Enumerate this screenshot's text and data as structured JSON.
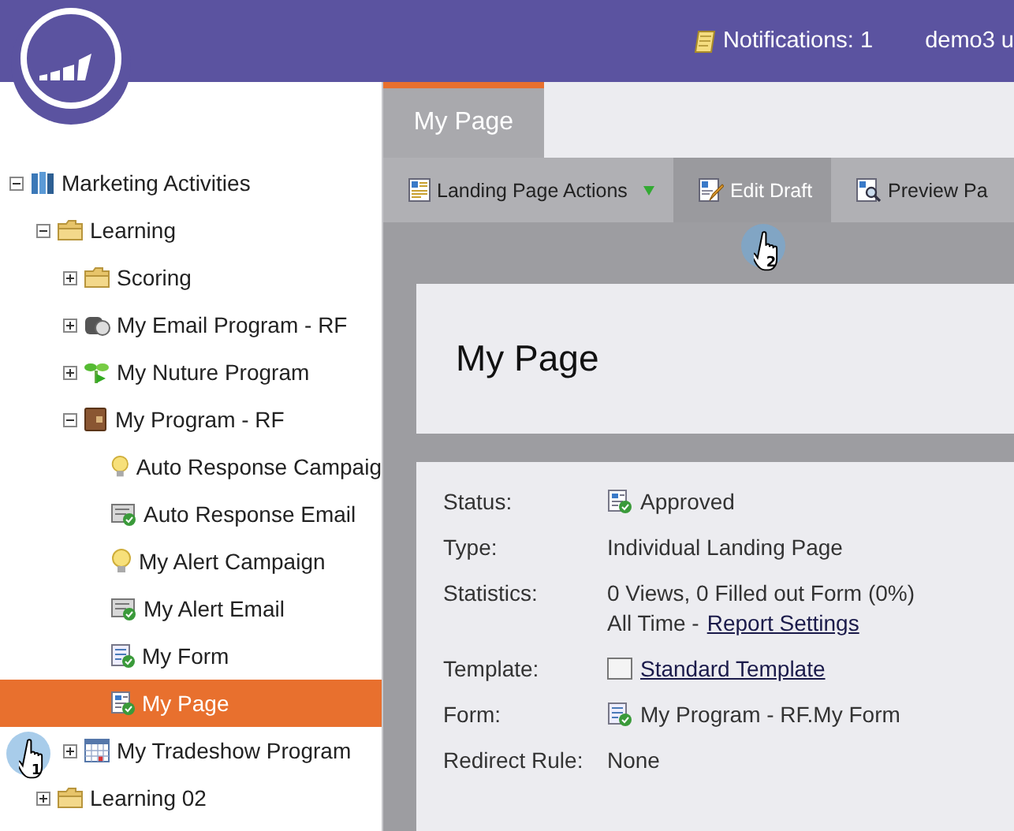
{
  "header": {
    "notifications": "Notifications: 1",
    "user": "demo3 u"
  },
  "tree": [
    {
      "label": "Marketing Activities",
      "kind": "workspace",
      "expanded": true,
      "selected": false,
      "children": [
        {
          "label": "Learning",
          "kind": "folder",
          "expanded": true,
          "selected": false,
          "children": [
            {
              "label": "Scoring",
              "kind": "folder",
              "expanded": false,
              "selected": false
            },
            {
              "label": "My Email Program - RF",
              "kind": "email-program",
              "expanded": false,
              "selected": false
            },
            {
              "label": "My Nuture Program",
              "kind": "nurture",
              "expanded": false,
              "selected": false
            },
            {
              "label": "My Program - RF",
              "kind": "program",
              "expanded": true,
              "selected": false,
              "children": [
                {
                  "label": "Auto Response Campaig",
                  "kind": "campaign",
                  "selected": false
                },
                {
                  "label": "Auto Response Email",
                  "kind": "email",
                  "selected": false
                },
                {
                  "label": "My Alert Campaign",
                  "kind": "campaign",
                  "selected": false
                },
                {
                  "label": "My Alert Email",
                  "kind": "email",
                  "selected": false
                },
                {
                  "label": "My Form",
                  "kind": "form",
                  "selected": false
                },
                {
                  "label": "My Page",
                  "kind": "page",
                  "selected": true
                }
              ]
            },
            {
              "label": "My Tradeshow Program",
              "kind": "event",
              "expanded": false,
              "selected": false
            }
          ]
        },
        {
          "label": "Learning 02",
          "kind": "folder",
          "expanded": false,
          "selected": false
        }
      ]
    }
  ],
  "tabs": [
    {
      "label": "My Page",
      "selected": true
    }
  ],
  "toolbar": [
    {
      "label": "Landing Page Actions",
      "kind": "actions",
      "menu": true,
      "selected": false
    },
    {
      "label": "Edit Draft",
      "kind": "edit",
      "menu": false,
      "selected": true
    },
    {
      "label": "Preview Pa",
      "kind": "preview",
      "selected": false
    }
  ],
  "title": "My Page",
  "details": [
    {
      "label": "Status:",
      "lines": [
        {
          "kind": "page",
          "text": "Approved"
        }
      ]
    },
    {
      "label": "Type:",
      "lines": [
        {
          "text": "Individual Landing Page"
        }
      ]
    },
    {
      "label": "Statistics:",
      "lines": [
        {
          "text": "0 Views, 0 Filled out Form (0%)"
        },
        {
          "text": "All Time -",
          "link": "Report Settings"
        }
      ]
    },
    {
      "label": "Template:",
      "lines": [
        {
          "kind": "template",
          "link": "Standard Template"
        }
      ]
    },
    {
      "label": "Form:",
      "lines": [
        {
          "kind": "form",
          "text": "My Program - RF.My Form"
        }
      ]
    },
    {
      "label": "Redirect Rule:",
      "lines": [
        {
          "text": "None"
        }
      ]
    }
  ],
  "callouts": [
    {
      "number": "1"
    },
    {
      "number": "2"
    }
  ]
}
